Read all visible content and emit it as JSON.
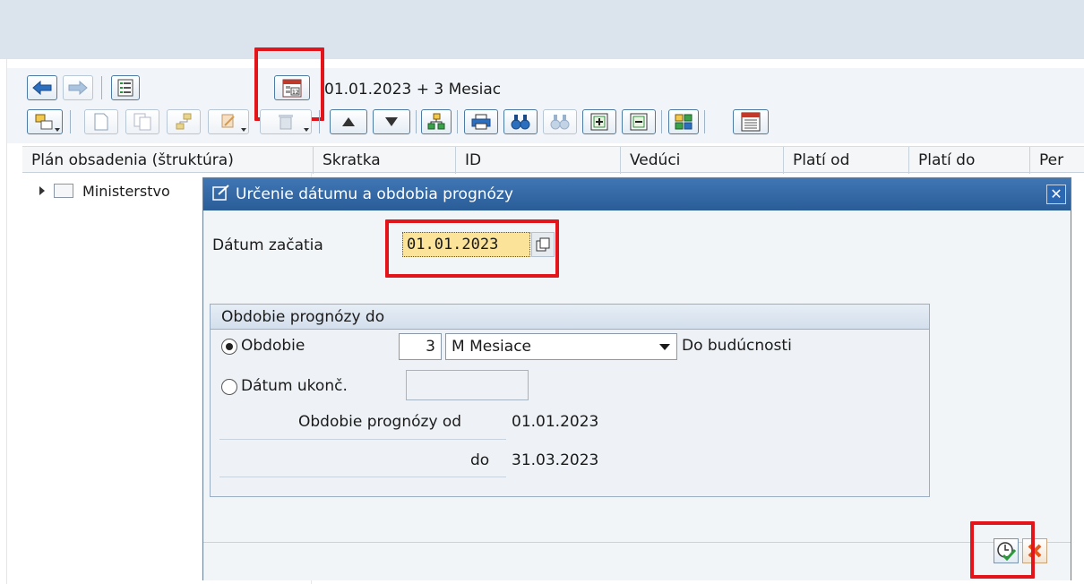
{
  "toolbar": {
    "forecast_info": "01.01.2023  + 3 Mesiac"
  },
  "columns": [
    "Plán obsadenia (štruktúra)",
    "Skratka",
    "ID",
    "Vedúci",
    "Platí od",
    "Platí do",
    "Per"
  ],
  "tree": {
    "root_label": "Ministerstvo"
  },
  "dialog": {
    "title": "Určenie dátumu a obdobia prognózy",
    "start_date_label": "Dátum začatia",
    "start_date_value": "01.01.2023",
    "group_title": "Obdobie prognózy do",
    "period_option": "Obdobie",
    "period_number": "3",
    "period_unit": "M Mesiace",
    "period_suffix": "Do budúcnosti",
    "end_date_option": "Dátum ukonč.",
    "end_date_value": "",
    "forecast_from_label": "Obdobie prognózy od",
    "forecast_from_value": "01.01.2023",
    "forecast_to_label": "do",
    "forecast_to_value": "31.03.2023"
  },
  "colors": {
    "title_bar": "#2f67a6",
    "highlight": "#e3151a",
    "required_field": "#fbe39a"
  }
}
